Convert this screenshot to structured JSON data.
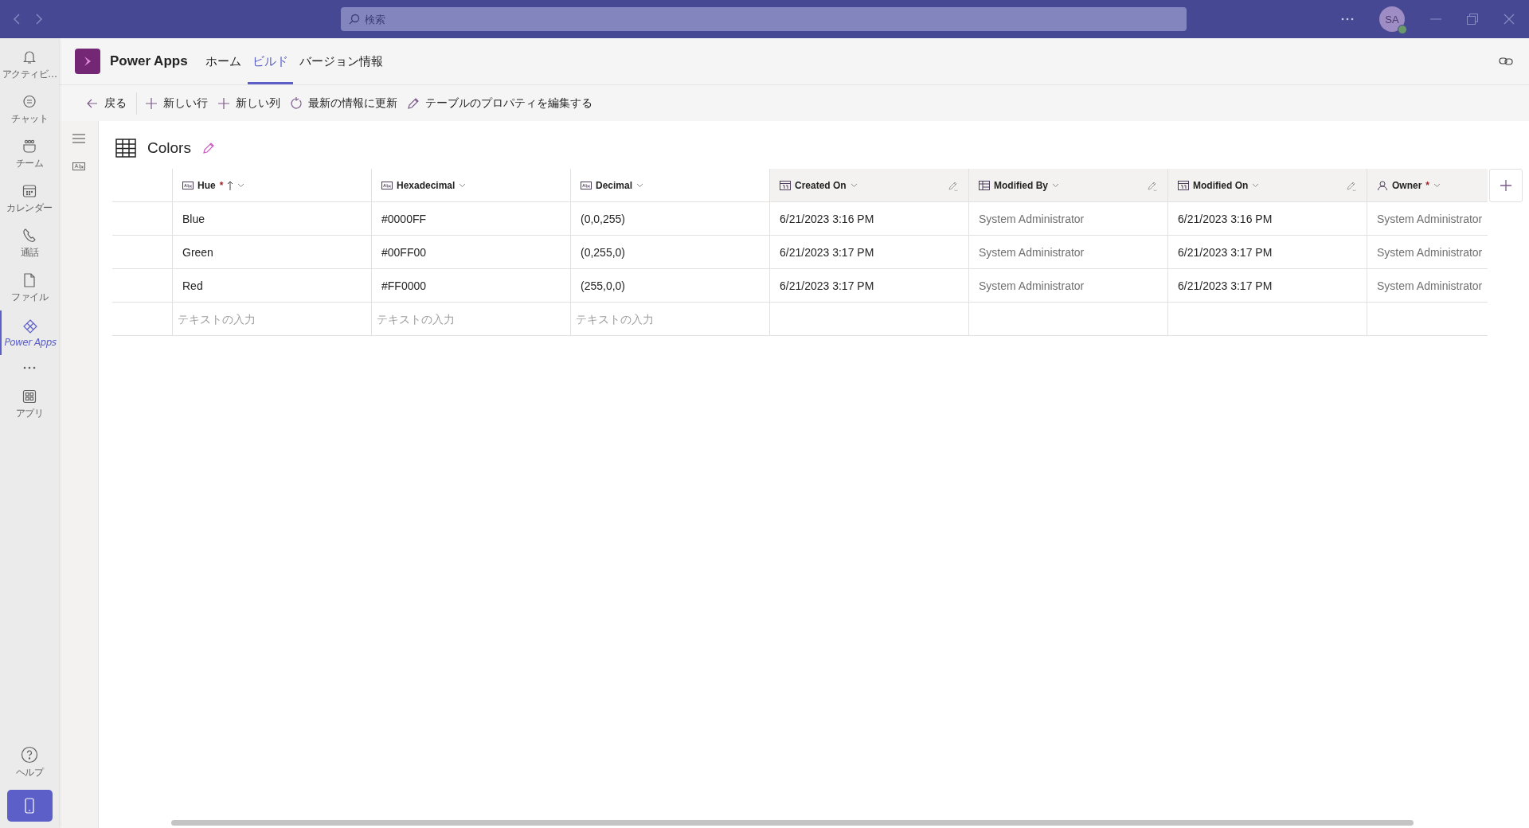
{
  "title_bar": {
    "search": {
      "placeholder": "検索"
    },
    "avatar": "SA"
  },
  "rail": {
    "items": [
      {
        "label": "アクティビ…",
        "selected": false
      },
      {
        "label": "チャット",
        "selected": false
      },
      {
        "label": "チーム",
        "selected": false
      },
      {
        "label": "カレンダー",
        "selected": false
      },
      {
        "label": "通話",
        "selected": false
      },
      {
        "label": "ファイル",
        "selected": false
      },
      {
        "label": "Power Apps",
        "selected": true
      }
    ],
    "extra_items": [
      {
        "label": "アプリ",
        "selected": false
      }
    ],
    "help": {
      "label": "ヘルプ"
    }
  },
  "app": {
    "name": "Power Apps",
    "tabs": [
      {
        "label": "ホーム",
        "selected": false
      },
      {
        "label": "ビルド",
        "selected": true
      },
      {
        "label": "バージョン情報",
        "selected": false
      }
    ]
  },
  "toolbar": [
    "戻る",
    "新しい行",
    "新しい列",
    "最新の情報に更新",
    "テーブルのプロパティを編集する"
  ],
  "table": {
    "title": "Colors",
    "columns": [
      {
        "name": "Hue",
        "kind": "text",
        "required_mark": "*",
        "sorted": true,
        "readonly": false
      },
      {
        "name": "Hexadecimal",
        "kind": "text",
        "sorted": false,
        "readonly": false
      },
      {
        "name": "Decimal",
        "kind": "text",
        "sorted": false,
        "readonly": false
      },
      {
        "name": "Created On",
        "kind": "date",
        "sorted": false,
        "readonly": true
      },
      {
        "name": "Modified By",
        "kind": "lookup",
        "sorted": false,
        "readonly": true
      },
      {
        "name": "Modified On",
        "kind": "date",
        "sorted": false,
        "readonly": true
      },
      {
        "name": "Owner",
        "kind": "person",
        "required_mark": "*",
        "sorted": false,
        "readonly": false
      }
    ],
    "rows": [
      {
        "cells": [
          "Blue",
          "#0000FF",
          "(0,0,255)",
          "6/21/2023 3:16 PM",
          "System Administrator",
          "6/21/2023 3:16 PM",
          "System Administrator"
        ]
      },
      {
        "cells": [
          "Green",
          "#00FF00",
          "(0,255,0)",
          "6/21/2023 3:17 PM",
          "System Administrator",
          "6/21/2023 3:17 PM",
          "System Administrator"
        ]
      },
      {
        "cells": [
          "Red",
          "#FF0000",
          "(255,0,0)",
          "6/21/2023 3:17 PM",
          "System Administrator",
          "6/21/2023 3:17 PM",
          "System Administrator"
        ]
      }
    ],
    "new_row": [
      {
        "placeholder": "テキストの入力"
      },
      {
        "placeholder": "テキストの入力"
      },
      {
        "placeholder": "テキストの入力"
      }
    ]
  }
}
